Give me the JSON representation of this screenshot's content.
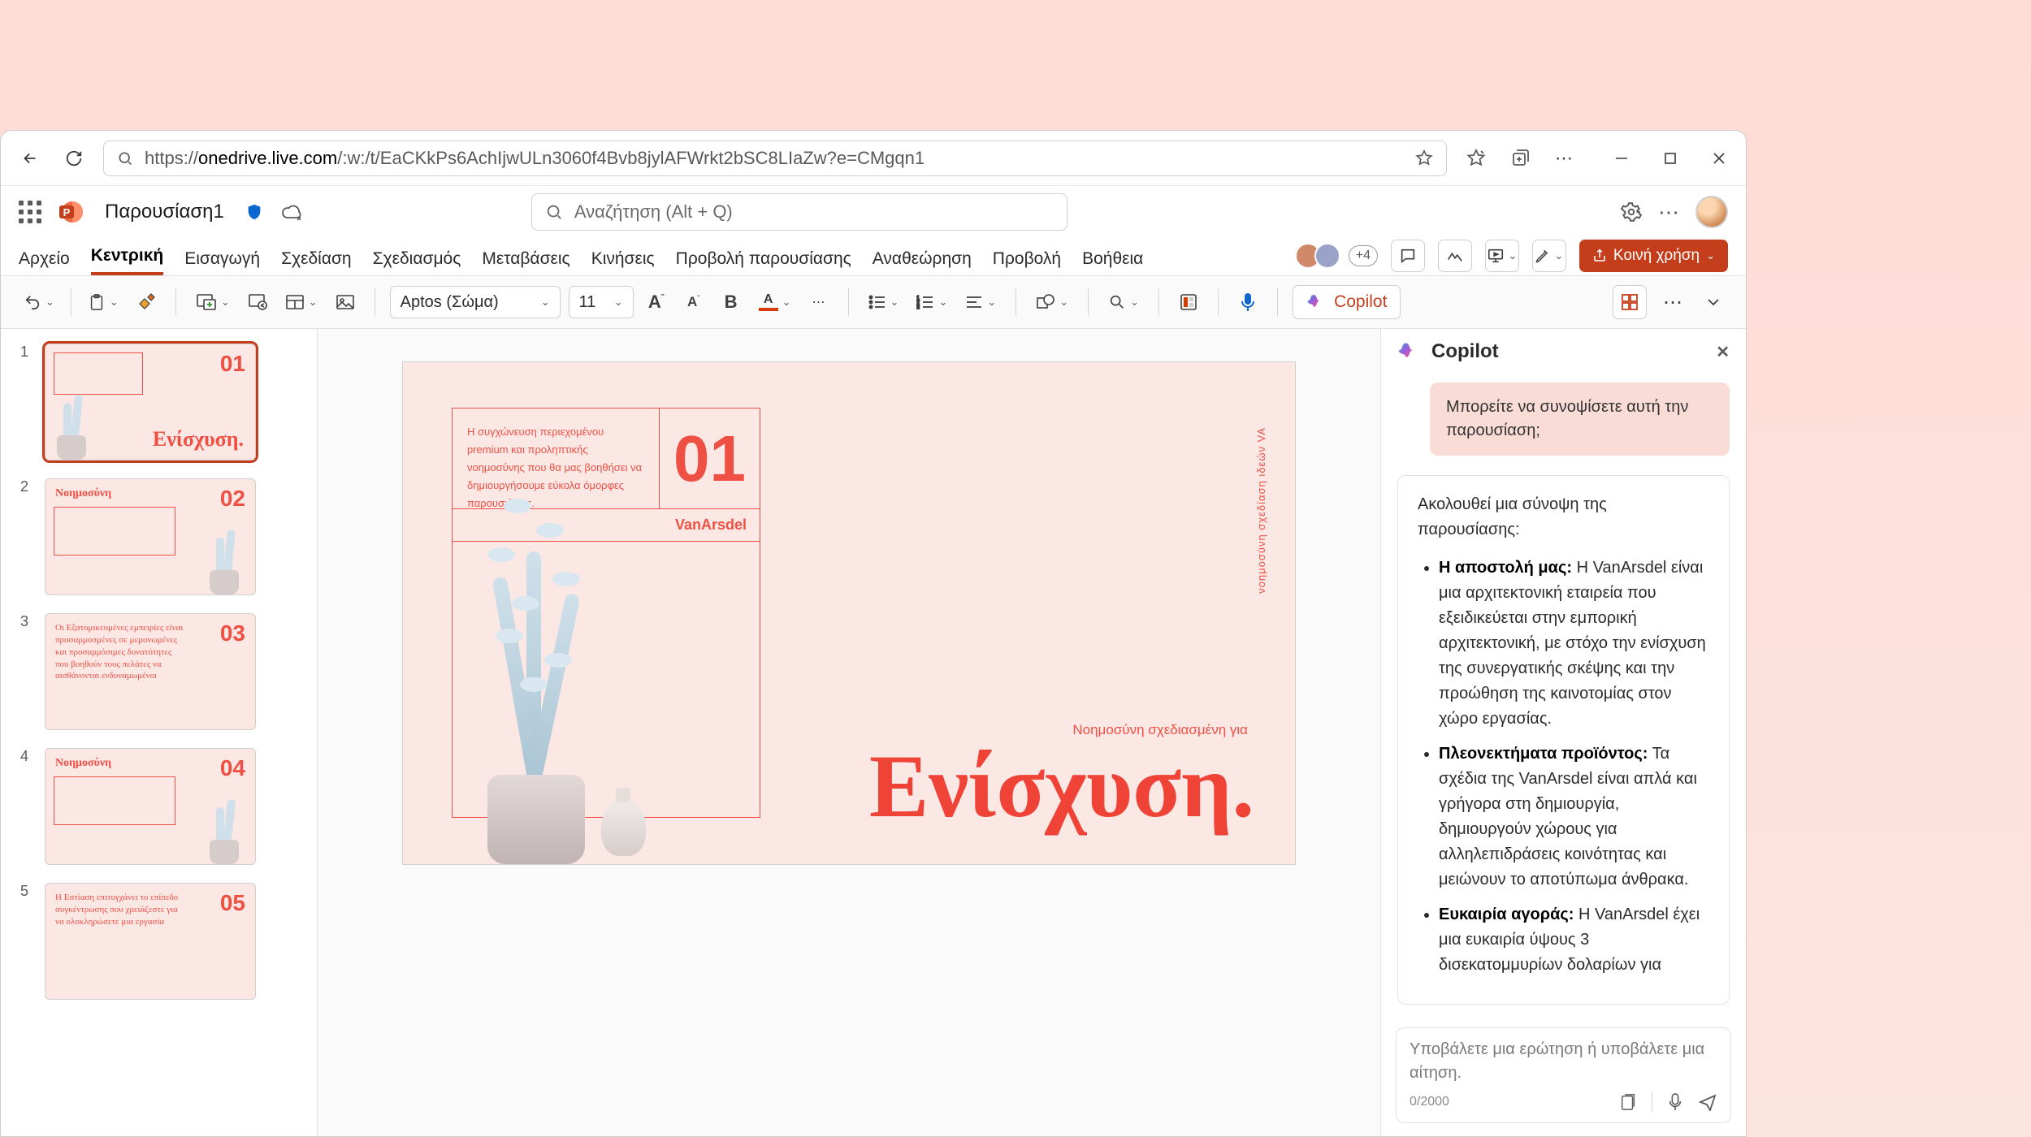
{
  "browser": {
    "url_prefix": "https://",
    "url_host": "onedrive.live.com",
    "url_path": "/:w:/t/EaCKkPs6AchIjwULn3060f4Bvb8jylAFWrkt2bSC8LIaZw?e=CMgqn1"
  },
  "header": {
    "doc_title": "Παρουσίαση1",
    "search_placeholder": "Αναζήτηση (Alt + Q)"
  },
  "ribbon": {
    "tabs": [
      "Αρχείο",
      "Κεντρική",
      "Εισαγωγή",
      "Σχεδίαση",
      "Σχεδιασμός",
      "Μεταβάσεις",
      "Κινήσεις",
      "Προβολή παρουσίασης",
      "Αναθεώρηση",
      "Προβολή",
      "Βοήθεια"
    ],
    "active_tab_index": 1,
    "presence_more": "+4",
    "share_label": "Κοινή χρήση"
  },
  "toolbar": {
    "font_name": "Aptos (Σώμα)",
    "font_size": "11",
    "copilot_label": "Copilot"
  },
  "thumbs": [
    {
      "num": "1",
      "big_num": "01",
      "title": "Ενίσχυση.",
      "selected": true,
      "layout": "title"
    },
    {
      "num": "2",
      "big_num": "02",
      "title": "Νοημοσύνη",
      "selected": false,
      "layout": "content"
    },
    {
      "num": "3",
      "big_num": "03",
      "title": "Οι Εξατομικευμένες εμπειρίες είναι προσαρμοσμένες σε μεμονωμένες και προσαρμόσιμες δυνατότητες που βοηθούν τους πελάτες να αισθάνονται ενδυναμωμένοι",
      "selected": false,
      "layout": "text"
    },
    {
      "num": "4",
      "big_num": "04",
      "title": "Νοημοσύνη",
      "selected": false,
      "layout": "content"
    },
    {
      "num": "5",
      "big_num": "05",
      "title": "Η Εστίαση επιτυγχάνει το επίπεδο συγκέντρωσης που χρειάζεστε για να ολοκληρώσετε μια εργασία",
      "selected": false,
      "layout": "text"
    }
  ],
  "slide": {
    "box_text": "Η συγχώνευση περιεχομένου premium και προληπτικής νοημοσύνης που θα μας βοηθήσει να δημιουργήσουμε εύκολα όμορφες παρουσιάσεις.",
    "big_num": "01",
    "brand": "VanArsdel",
    "subtitle": "Νοημοσύνη σχεδιασμένη για",
    "main_title": "Ενίσχυση.",
    "side_text": "νοημοσύνη σχεδίαση ιδεών VA"
  },
  "copilot": {
    "title": "Copilot",
    "user_msg": "Μπορείτε να συνοψίσετε αυτή την παρουσίαση;",
    "intro": "Ακολουθεί μια σύνοψη της παρουσίασης:",
    "bullets": [
      {
        "label": "Η αποστολή μας:",
        "body": " Η VanArsdel είναι μια αρχιτεκτονική εταιρεία που εξειδικεύεται στην εμπορική αρχιτεκτονική, με στόχο την ενίσχυση της συνεργατικής σκέψης και την προώθηση της καινοτομίας στον χώρο εργασίας."
      },
      {
        "label": "Πλεονεκτήματα προϊόντος:",
        "body": " Τα σχέδια της VanArsdel είναι απλά και γρήγορα στη δημιουργία, δημιουργούν χώρους για αλληλεπιδράσεις κοινότητας και μειώνουν το αποτύπωμα άνθρακα."
      },
      {
        "label": "Ευκαιρία αγοράς:",
        "body": " Η VanArsdel έχει μια ευκαιρία ύψους 3 δισεκατομμυρίων δολαρίων για"
      }
    ],
    "input_placeholder": "Υποβάλετε μια ερώτηση ή υποβάλετε μια αίτηση.",
    "counter": "0/2000"
  }
}
